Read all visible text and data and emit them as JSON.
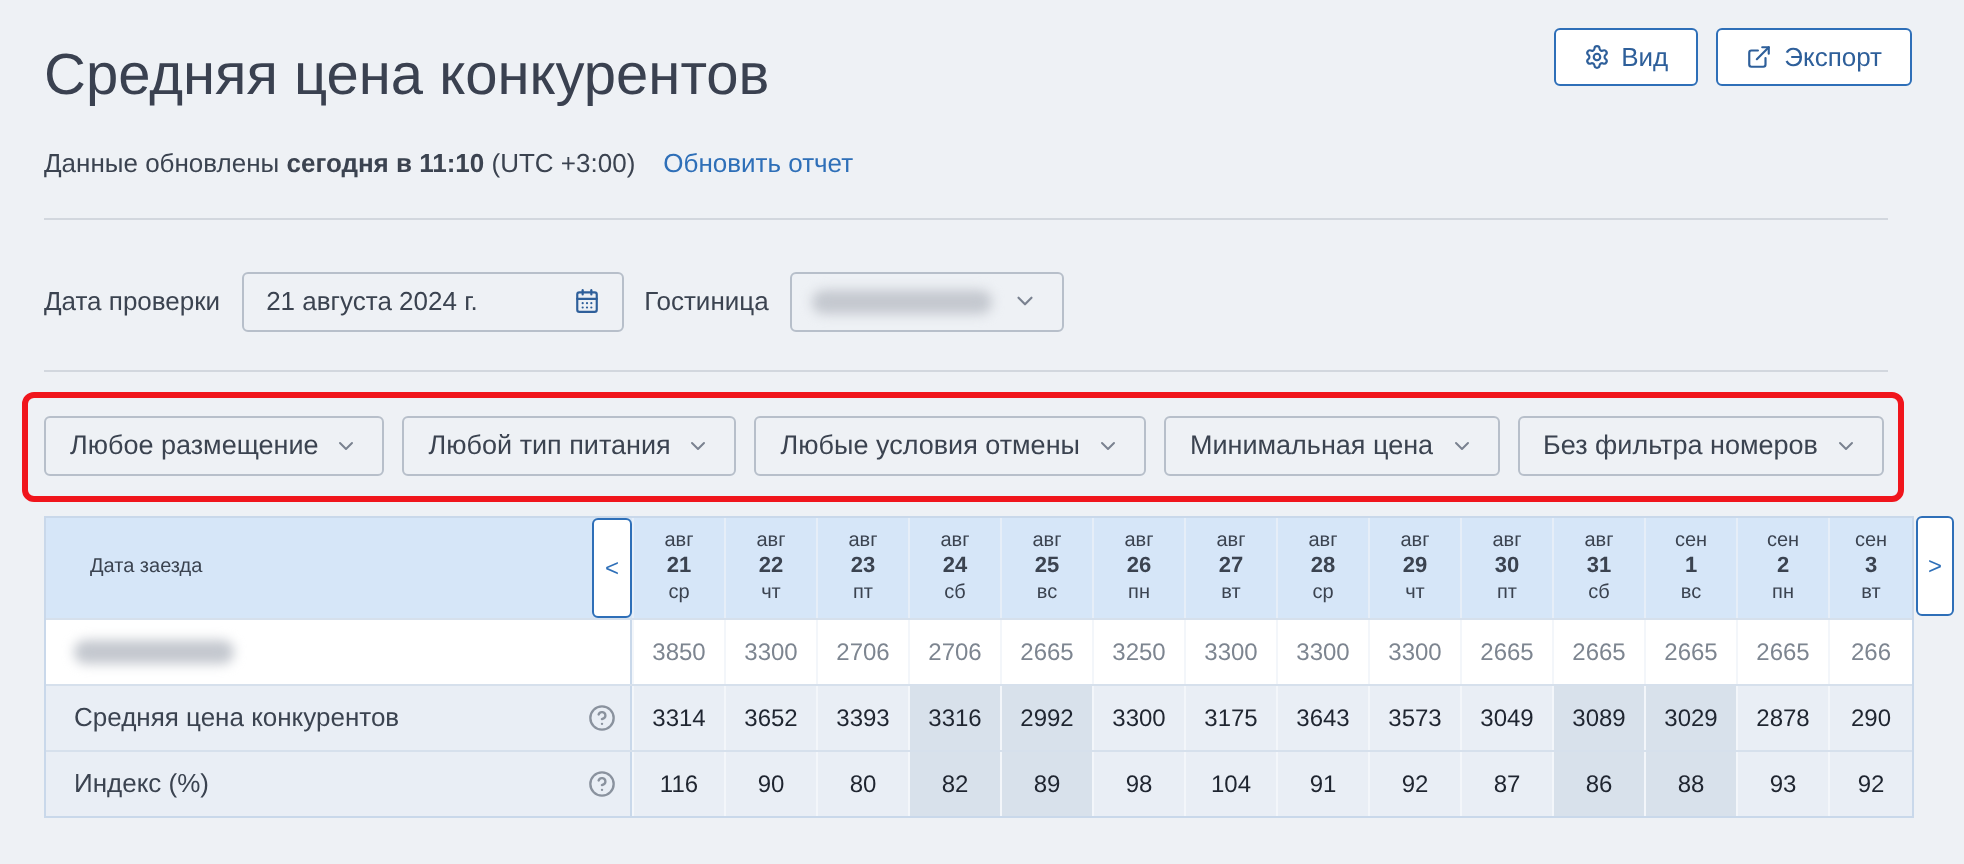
{
  "title": "Средняя цена конкурентов",
  "header_buttons": [
    {
      "kind": "settings",
      "label": "Вид"
    },
    {
      "kind": "export",
      "label": "Экспорт"
    }
  ],
  "update_info": {
    "text": "Данные обновлены **сегодня в 11:10** (UTC +3:00)",
    "link": "Обновить отчет"
  },
  "check_date": {
    "label": "Дата проверки",
    "value": "21 августа 2024 г."
  },
  "hotel": {
    "label": "Гостиница"
  },
  "filters": [
    "Любое размещение",
    "Любой тип питания",
    "Любые условия отмены",
    "Минимальная цена",
    "Без фильтра номеров"
  ],
  "table": {
    "header_label": "Дата заезда",
    "prev": "<",
    "next": ">",
    "dates": [
      {
        "month": "авг",
        "day": "21",
        "weekday": "ср",
        "weekend": false
      },
      {
        "month": "авг",
        "day": "22",
        "weekday": "чт",
        "weekend": false
      },
      {
        "month": "авг",
        "day": "23",
        "weekday": "пт",
        "weekend": false
      },
      {
        "month": "авг",
        "day": "24",
        "weekday": "сб",
        "weekend": true
      },
      {
        "month": "авг",
        "day": "25",
        "weekday": "вс",
        "weekend": true
      },
      {
        "month": "авг",
        "day": "26",
        "weekday": "пн",
        "weekend": false
      },
      {
        "month": "авг",
        "day": "27",
        "weekday": "вт",
        "weekend": false
      },
      {
        "month": "авг",
        "day": "28",
        "weekday": "ср",
        "weekend": false
      },
      {
        "month": "авг",
        "day": "29",
        "weekday": "чт",
        "weekend": false
      },
      {
        "month": "авг",
        "day": "30",
        "weekday": "пт",
        "weekend": false
      },
      {
        "month": "авг",
        "day": "31",
        "weekday": "сб",
        "weekend": true
      },
      {
        "month": "сен",
        "day": "1",
        "weekday": "вс",
        "weekend": true
      },
      {
        "month": "сен",
        "day": "2",
        "weekday": "пн",
        "weekend": false
      },
      {
        "month": "сен",
        "day": "3",
        "weekday": "вт",
        "weekend": false
      }
    ],
    "rows": [
      {
        "kind": "hotel",
        "values": [
          "3850",
          "3300",
          "2706",
          "2706",
          "2665",
          "3250",
          "3300",
          "3300",
          "3300",
          "2665",
          "2665",
          "2665",
          "2665",
          "266"
        ]
      },
      {
        "kind": "metric",
        "label": "Средняя цена конкурентов",
        "values": [
          "3314",
          "3652",
          "3393",
          "3316",
          "2992",
          "3300",
          "3175",
          "3643",
          "3573",
          "3049",
          "3089",
          "3029",
          "2878",
          "290"
        ]
      },
      {
        "kind": "metric",
        "label": "Индекс (%)",
        "values": [
          "116",
          "90",
          "80",
          "82",
          "89",
          "98",
          "104",
          "91",
          "92",
          "87",
          "86",
          "88",
          "93",
          "92"
        ]
      }
    ]
  }
}
